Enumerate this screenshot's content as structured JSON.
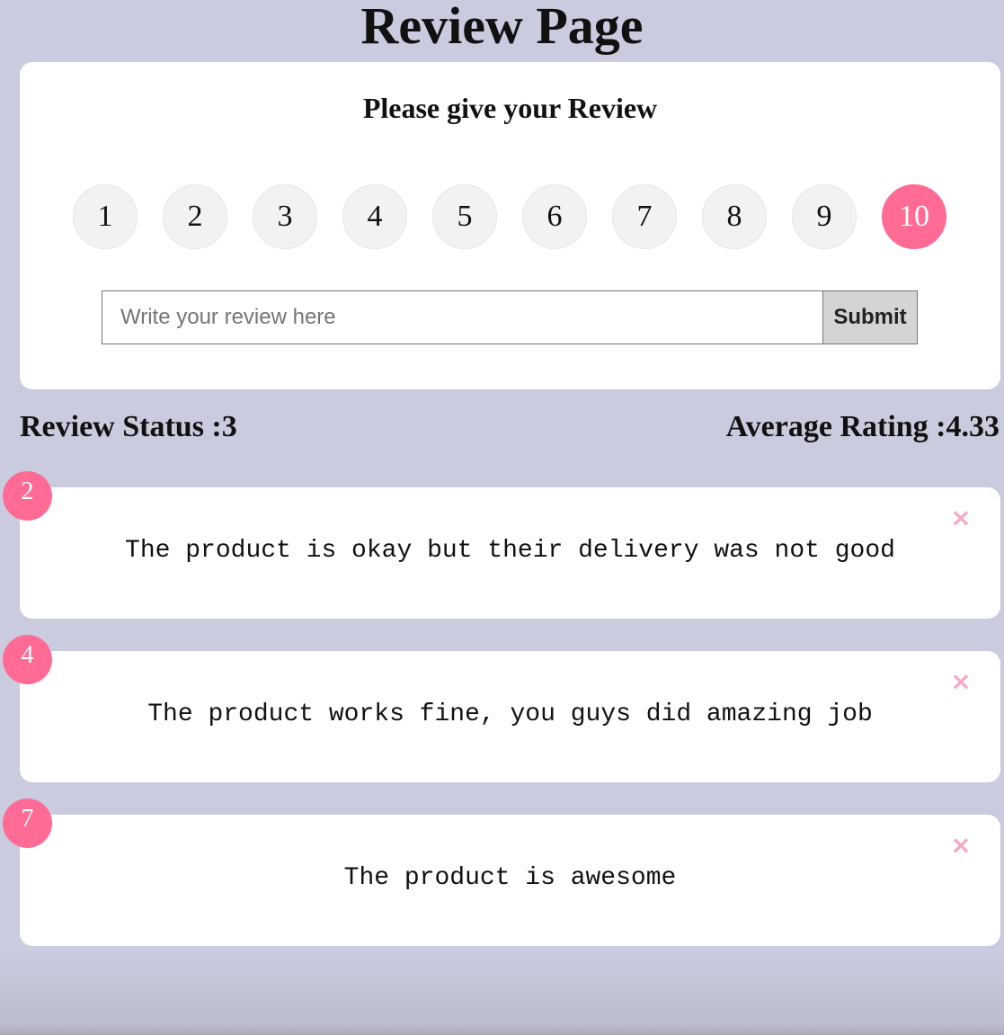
{
  "page": {
    "title": "Review Page"
  },
  "review_form": {
    "heading": "Please give your Review",
    "ratings": [
      "1",
      "2",
      "3",
      "4",
      "5",
      "6",
      "7",
      "8",
      "9",
      "10"
    ],
    "selected_rating": "10",
    "input_placeholder": "Write your review here",
    "input_value": "",
    "submit_label": "Submit"
  },
  "stats": {
    "review_status": "Review Status :3",
    "average_rating": "Average Rating :4.33"
  },
  "reviews": [
    {
      "rating": "2",
      "text": "The product is okay but their delivery was not good",
      "delete_icon": "×"
    },
    {
      "rating": "4",
      "text": "The product works fine, you guys did amazing job",
      "delete_icon": "×"
    },
    {
      "rating": "7",
      "text": "The product is awesome",
      "delete_icon": "×"
    }
  ],
  "colors": {
    "background": "#cbcbdf",
    "accent": "#ff6b95",
    "delete": "#f7a8be"
  }
}
